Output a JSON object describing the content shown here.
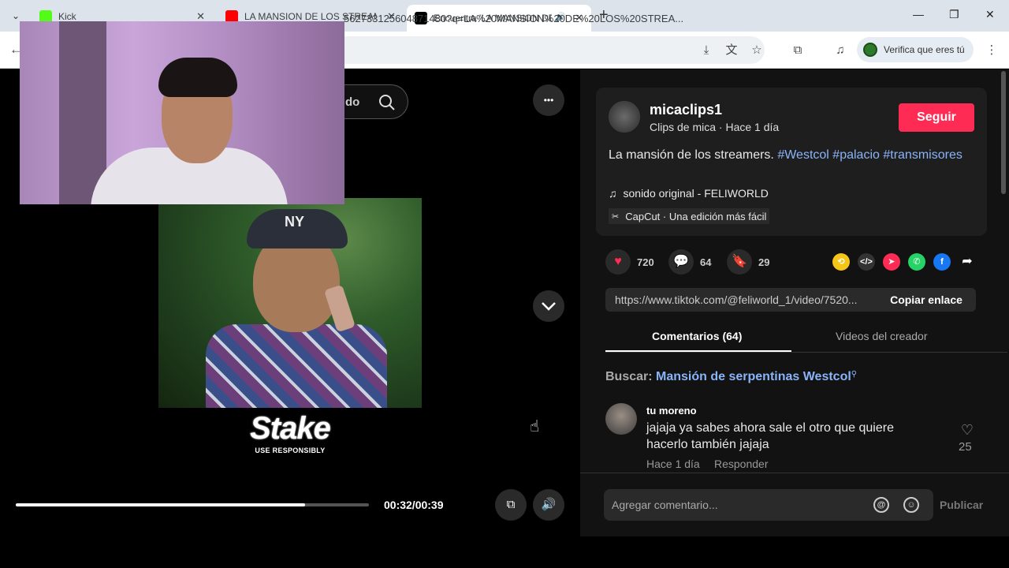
{
  "browser": {
    "tabs": [
      {
        "title": "Kick",
        "color": "#53fc18"
      },
      {
        "title": "LA MANSION DE LOS STREAMERS",
        "color": "#ff0000"
      },
      {
        "title": "Encuentra 'LA MANSION DE",
        "color": "#000000"
      }
    ],
    "new_tab": "+",
    "url": "562733125604871480?q=LA%20MANSION%20DE%20LOS%20STREA...",
    "verify_label": "Verifica que eres tú",
    "back": "←"
  },
  "video": {
    "search_label": "do",
    "brand": "Stake",
    "brand_sub": "USE RESPONSIBLY",
    "cap_logo": "NY",
    "time": "00:32/00:39",
    "progress": 0.82,
    "more": "•••",
    "down": "⌄"
  },
  "post": {
    "username": "micaclips1",
    "subtitle": "Clips de mica · Hace 1 día",
    "follow_label": "Seguir",
    "desc_text": "La mansión de los streamers. ",
    "tags": [
      "#Westcol",
      "#palacio",
      "#transmisores"
    ],
    "music": "sonido original - FELIWORLD",
    "capcut": "CapCut · Una edición más fácil",
    "likes": "720",
    "comments": "64",
    "saves": "29",
    "link": "https://www.tiktok.com/@feliworld_1/video/7520...",
    "copy_label": "Copiar enlace"
  },
  "tabs": {
    "comments": "Comentarios (64)",
    "videos": "Videos del creador"
  },
  "suggest": {
    "prefix": "Buscar:",
    "query": "Mansión de serpentinas Westcol"
  },
  "comment": {
    "user": "tu moreno",
    "text": "jajaja ya sabes ahora sale el otro que quiere hacerlo también jajaja",
    "time": "Hace 1 día",
    "reply": "Responder",
    "likes": "25"
  },
  "compose": {
    "placeholder": "Agregar comentario...",
    "publish": "Publicar"
  },
  "colors": {
    "accent": "#fe2c55",
    "link": "#8ab4f8"
  }
}
